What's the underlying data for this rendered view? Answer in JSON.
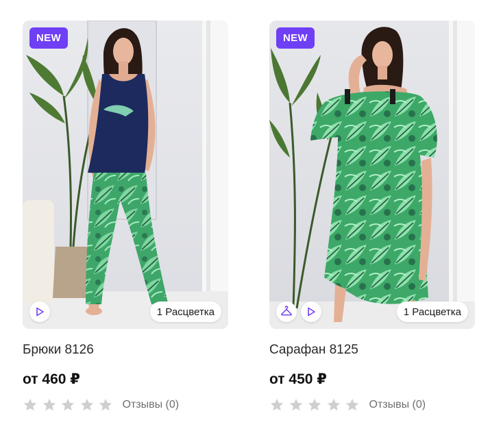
{
  "products": [
    {
      "badge": "NEW",
      "colors_label": "1 Расцветка",
      "title": "Брюки 8126",
      "price": "от 460 ₽",
      "reviews": "Отзывы (0)",
      "rating": 0,
      "icons": [
        "play-icon"
      ]
    },
    {
      "badge": "NEW",
      "colors_label": "1 Расцветка",
      "title": "Сарафан 8125",
      "price": "от 450 ₽",
      "reviews": "Отзывы (0)",
      "rating": 0,
      "icons": [
        "hanger-icon",
        "play-icon"
      ]
    }
  ],
  "colors": {
    "accent": "#6f3ff5",
    "star_empty": "#cfcfcf",
    "print_green": "#3fa66a",
    "navy_top": "#1c2a5e"
  }
}
